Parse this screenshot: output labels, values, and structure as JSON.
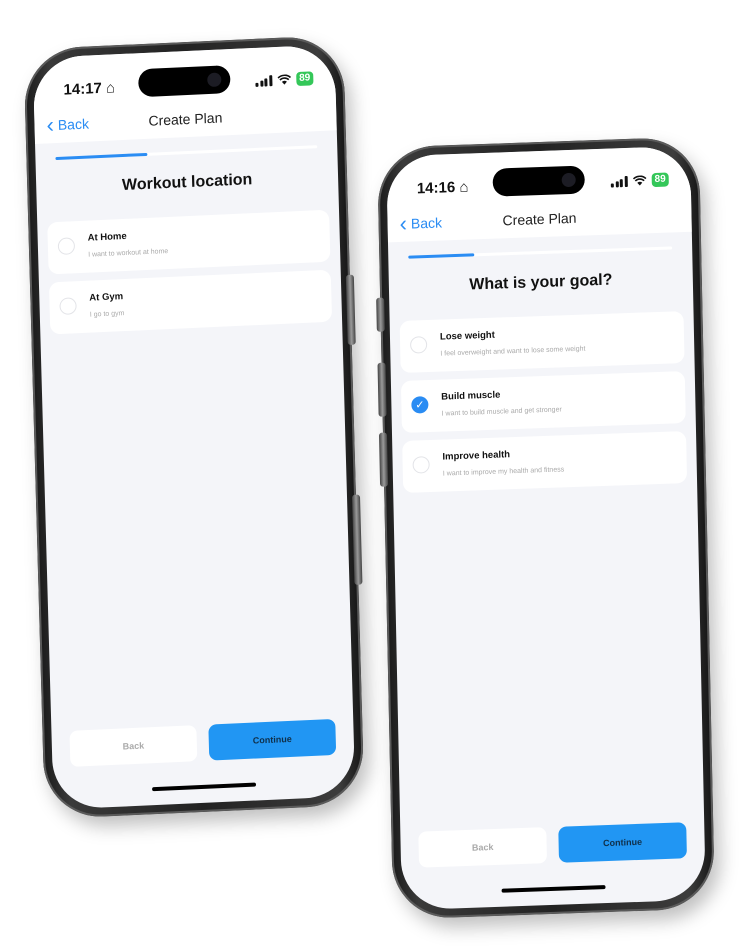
{
  "phones": [
    {
      "status": {
        "time": "14:17",
        "battery": "89"
      },
      "nav": {
        "back_label": "Back",
        "title": "Create Plan"
      },
      "progress": 0.35,
      "heading": "Workout location",
      "options": [
        {
          "title": "At Home",
          "subtitle": "I want to workout at home",
          "selected": false
        },
        {
          "title": "At Gym",
          "subtitle": "I go to gym",
          "selected": false
        }
      ],
      "footer": {
        "back_label": "Back",
        "continue_label": "Continue"
      }
    },
    {
      "status": {
        "time": "14:16",
        "battery": "89"
      },
      "nav": {
        "back_label": "Back",
        "title": "Create Plan"
      },
      "progress": 0.25,
      "heading": "What is your goal?",
      "options": [
        {
          "title": "Lose weight",
          "subtitle": "I feel overweight and want to lose some weight",
          "selected": false
        },
        {
          "title": "Build muscle",
          "subtitle": "I want to build muscle and get stronger",
          "selected": true
        },
        {
          "title": "Improve health",
          "subtitle": "I want to improve my health and fitness",
          "selected": false
        }
      ],
      "footer": {
        "back_label": "Back",
        "continue_label": "Continue"
      }
    }
  ],
  "icons": {
    "home": "⌂",
    "chevron_left": "‹",
    "wifi": "wifi",
    "check": "✓"
  },
  "colors": {
    "accent": "#2a8cf3",
    "continue_bg": "#2196f3",
    "battery": "#34c759"
  }
}
